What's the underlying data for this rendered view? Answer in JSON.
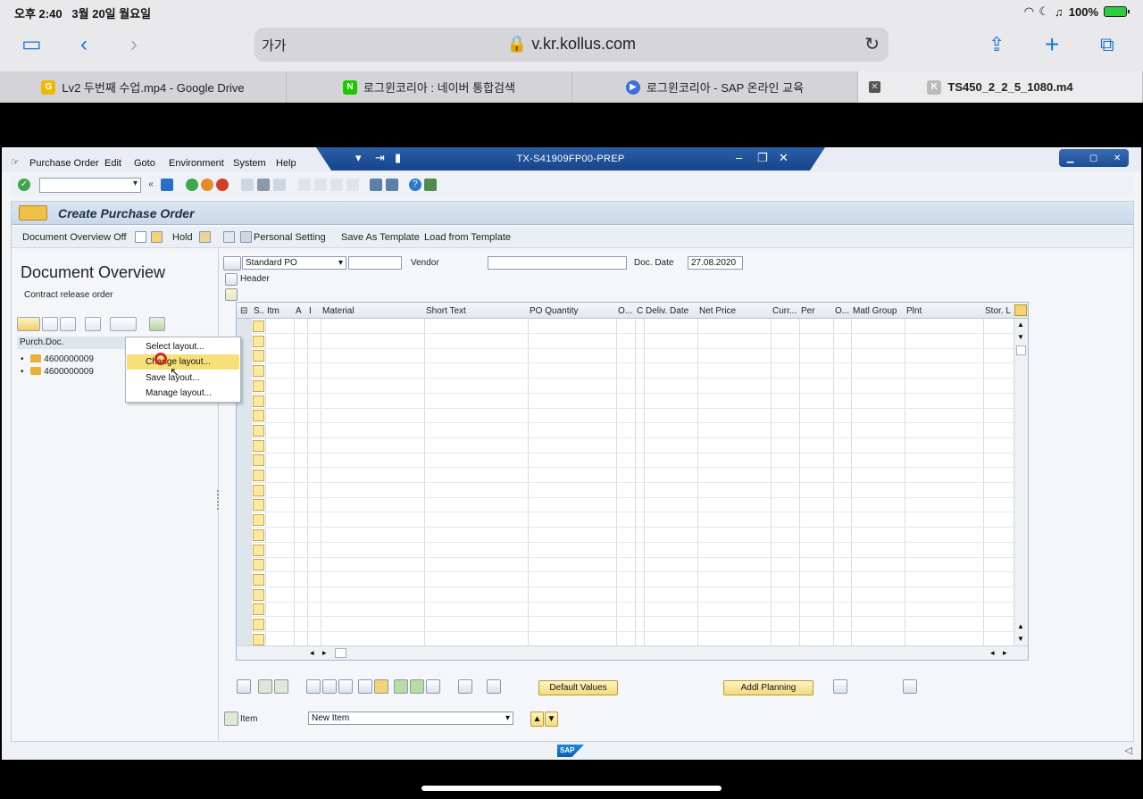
{
  "status_bar": {
    "time": "오후 2:40",
    "date": "3월 20일 월요일",
    "battery": "100%"
  },
  "browser": {
    "text_size_btn": "가가",
    "url": "v.kr.kollus.com"
  },
  "tabs": [
    {
      "label": "Lv2 두번째 수업.mp4 - Google Drive",
      "favicon": "G"
    },
    {
      "label": "로그윈코리아 : 네이버 통합검색",
      "favicon": "N"
    },
    {
      "label": "로그윈코리아 - SAP 온라인 교육",
      "favicon": "▶"
    },
    {
      "label": "TS450_2_2_5_1080.m4",
      "favicon": "K"
    }
  ],
  "sap": {
    "menus": [
      "Purchase Order",
      "Edit",
      "Goto",
      "Environment",
      "System",
      "Help"
    ],
    "system_title": "TX-S41909FP00-PREP",
    "screen_title": "Create Purchase Order",
    "app_toolbar": {
      "doc_overview_off": "Document Overview Off",
      "hold": "Hold",
      "personal_setting": "Personal Setting",
      "save_as_template": "Save As Template",
      "load_from_template": "Load from Template"
    },
    "left_pane": {
      "title": "Document Overview",
      "subtitle": "Contract release order",
      "column_header": "Purch.Doc.",
      "rows": [
        "4600000009",
        "4600000009"
      ]
    },
    "context_menu": [
      "Select layout...",
      "Change layout...",
      "Save layout...",
      "Manage layout..."
    ],
    "header": {
      "doc_type": "Standard PO",
      "vendor_label": "Vendor",
      "doc_date_label": "Doc. Date",
      "doc_date": "27.08.2020",
      "header_label": "Header"
    },
    "grid_columns": [
      "S..",
      "Itm",
      "A",
      "I",
      "Material",
      "Short Text",
      "PO Quantity",
      "O...",
      "C",
      "Deliv. Date",
      "Net Price",
      "Curr...",
      "Per",
      "O...",
      "Matl Group",
      "Plnt",
      "Stor. L"
    ],
    "bottom": {
      "default_values": "Default Values",
      "addl_planning": "Addl Planning",
      "item_label": "Item",
      "item_value": "New Item"
    },
    "footer_logo": "SAP"
  }
}
